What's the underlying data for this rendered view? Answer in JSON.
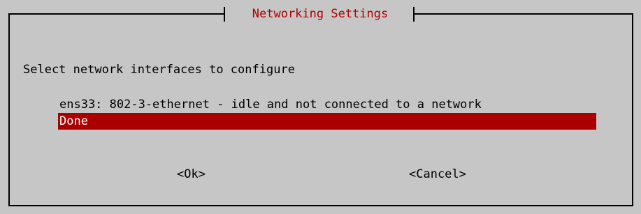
{
  "dialog": {
    "title": "Networking Settings",
    "prompt": "Select network interfaces to configure",
    "items": [
      {
        "label": "ens33: 802-3-ethernet - idle and not connected to a network",
        "selected": false
      },
      {
        "label": "Done",
        "selected": true
      }
    ],
    "buttons": {
      "ok_label": "<Ok>",
      "cancel_label": "<Cancel>"
    }
  },
  "colors": {
    "background": "#c6c6c6",
    "title": "#b40000",
    "selection": "#aa0000",
    "selection_text": "#ffffff",
    "text": "#000000"
  }
}
